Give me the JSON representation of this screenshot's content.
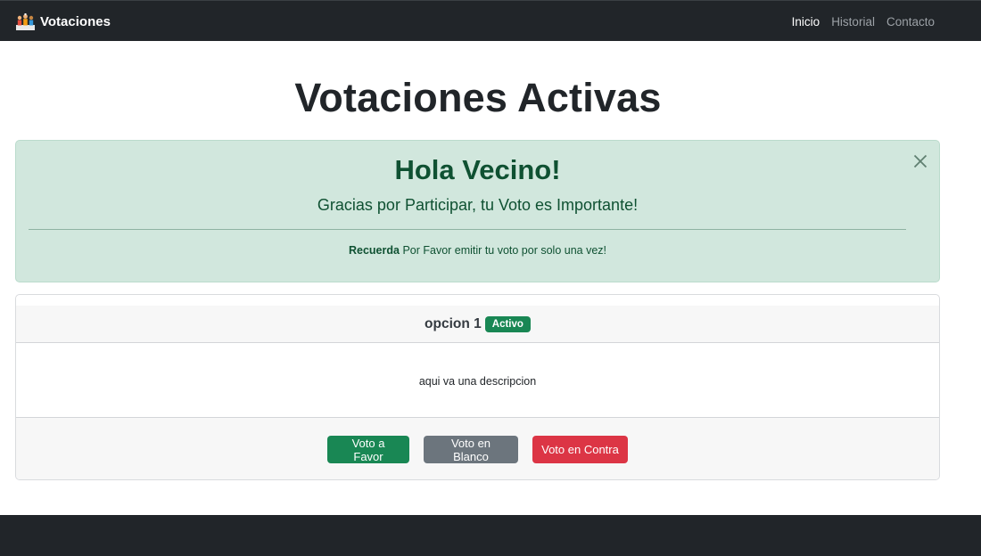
{
  "navbar": {
    "brand": "Votaciones",
    "brand_icon": "ballot-people-icon",
    "links": [
      {
        "label": "Inicio",
        "active": true
      },
      {
        "label": "Historial",
        "active": false
      },
      {
        "label": "Contacto",
        "active": false
      }
    ]
  },
  "page": {
    "title": "Votaciones Activas"
  },
  "alert": {
    "heading": "Hola Vecino!",
    "lead": "Gracias por Participar, tu Voto es Importante!",
    "note_bold": "Recuerda",
    "note_text": "Por Favor emitir tu voto por solo una vez!"
  },
  "card": {
    "title": "opcion 1",
    "badge": "Activo",
    "description": "aqui va una descripcion",
    "buttons": {
      "favor": "Voto a Favor",
      "blanco": "Voto en Blanco",
      "contra": "Voto en Contra"
    }
  },
  "colors": {
    "navbar": "#212529",
    "success": "#198754",
    "secondary": "#6c757d",
    "danger": "#dc3545",
    "alert_bg": "#d1e7dd",
    "alert_text": "#0f5132"
  }
}
